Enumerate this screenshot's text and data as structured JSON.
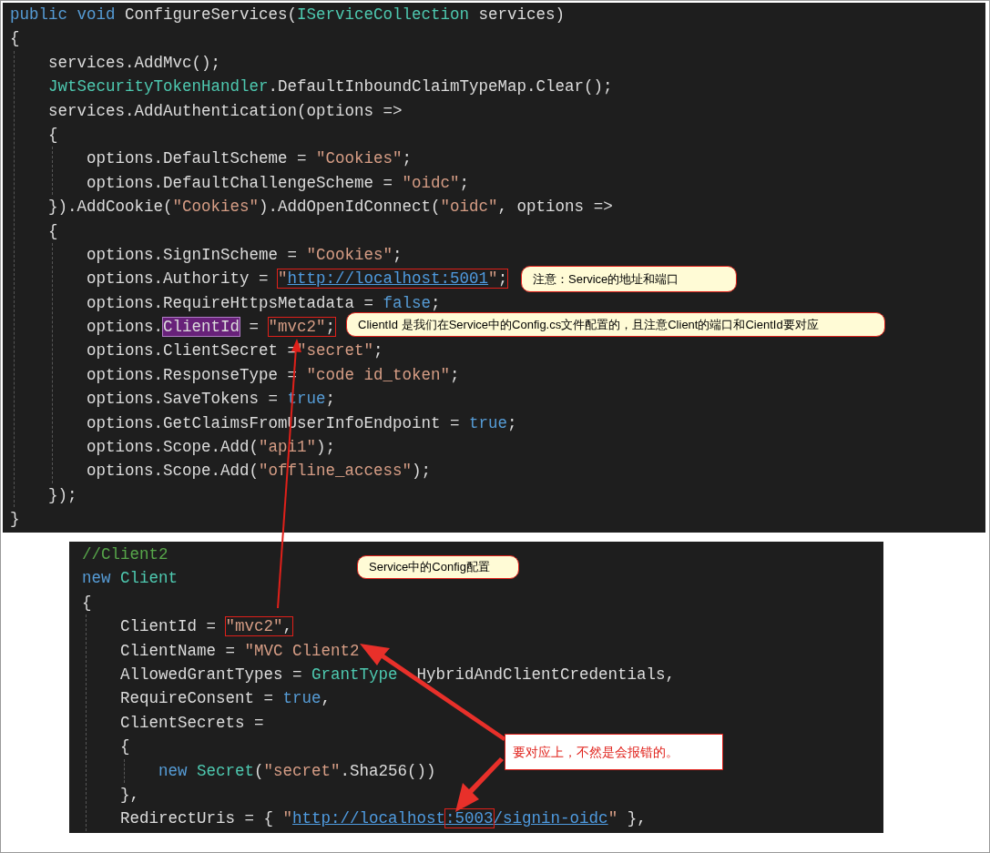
{
  "main_code": {
    "lines": [
      [
        {
          "kind": "keyword",
          "text": "public void"
        },
        {
          "kind": "plain",
          "text": " ConfigureServices("
        },
        {
          "kind": "type",
          "text": "IServiceCollection"
        },
        {
          "kind": "plain",
          "text": " services)"
        }
      ],
      [
        {
          "kind": "plain",
          "text": "{"
        }
      ],
      {
        "children": [
          [
            {
              "kind": "plain",
              "text": "services.AddMvc();"
            }
          ],
          [
            {
              "kind": "type",
              "text": "JwtSecurityTokenHandler"
            },
            {
              "kind": "plain",
              "text": ".DefaultInboundClaimTypeMap.Clear();"
            }
          ],
          [
            {
              "kind": "plain",
              "text": "services.AddAuthentication(options =>"
            }
          ],
          [
            {
              "kind": "plain",
              "text": "{"
            }
          ],
          {
            "children": [
              [
                {
                  "kind": "plain",
                  "text": "options.DefaultScheme = "
                },
                {
                  "kind": "string",
                  "text": "\"Cookies\""
                },
                {
                  "kind": "plain",
                  "text": ";"
                }
              ],
              [
                {
                  "kind": "plain",
                  "text": "options.DefaultChallengeScheme = "
                },
                {
                  "kind": "string",
                  "text": "\"oidc\""
                },
                {
                  "kind": "plain",
                  "text": ";"
                }
              ]
            ]
          },
          [
            {
              "kind": "plain",
              "text": "}).AddCookie("
            },
            {
              "kind": "string",
              "text": "\"Cookies\""
            },
            {
              "kind": "plain",
              "text": ").AddOpenIdConnect("
            },
            {
              "kind": "string",
              "text": "\"oidc\""
            },
            {
              "kind": "plain",
              "text": ", options =>"
            }
          ],
          [
            {
              "kind": "plain",
              "text": "{"
            }
          ],
          {
            "children": [
              [
                {
                  "kind": "plain",
                  "text": "options.SignInScheme = "
                },
                {
                  "kind": "string",
                  "text": "\"Cookies\""
                },
                {
                  "kind": "plain",
                  "text": ";"
                }
              ],
              [
                {
                  "kind": "plain",
                  "text": "options.Authority = "
                },
                {
                  "kind": "boxed",
                  "parts": [
                    {
                      "kind": "string",
                      "text": "\""
                    },
                    {
                      "kind": "link",
                      "text": "http://localhost:5001"
                    },
                    {
                      "kind": "string",
                      "text": "\""
                    },
                    {
                      "kind": "plain",
                      "text": ";"
                    }
                  ]
                }
              ],
              [
                {
                  "kind": "plain",
                  "text": "options.RequireHttpsMetadata = "
                },
                {
                  "kind": "keyword",
                  "text": "false"
                },
                {
                  "kind": "plain",
                  "text": ";"
                }
              ],
              [
                {
                  "kind": "plain",
                  "text": "options."
                },
                {
                  "kind": "highlight",
                  "text": "ClientId"
                },
                {
                  "kind": "plain",
                  "text": " = "
                },
                {
                  "kind": "boxed",
                  "parts": [
                    {
                      "kind": "string",
                      "text": "\"mvc2\""
                    },
                    {
                      "kind": "plain",
                      "text": ";"
                    }
                  ]
                }
              ],
              [
                {
                  "kind": "plain",
                  "text": "options.ClientSecret ="
                },
                {
                  "kind": "string",
                  "text": "\"secret\""
                },
                {
                  "kind": "plain",
                  "text": ";"
                }
              ],
              [
                {
                  "kind": "plain",
                  "text": "options.ResponseType = "
                },
                {
                  "kind": "string",
                  "text": "\"code id_token\""
                },
                {
                  "kind": "plain",
                  "text": ";"
                }
              ],
              [
                {
                  "kind": "plain",
                  "text": "options.SaveTokens = "
                },
                {
                  "kind": "keyword",
                  "text": "true"
                },
                {
                  "kind": "plain",
                  "text": ";"
                }
              ],
              [
                {
                  "kind": "plain",
                  "text": "options.GetClaimsFromUserInfoEndpoint = "
                },
                {
                  "kind": "keyword",
                  "text": "true"
                },
                {
                  "kind": "plain",
                  "text": ";"
                }
              ],
              [
                {
                  "kind": "plain",
                  "text": "options.Scope.Add("
                },
                {
                  "kind": "string",
                  "text": "\"api1\""
                },
                {
                  "kind": "plain",
                  "text": ");"
                }
              ],
              [
                {
                  "kind": "plain",
                  "text": "options.Scope.Add("
                },
                {
                  "kind": "string",
                  "text": "\"offline_access\""
                },
                {
                  "kind": "plain",
                  "text": ");"
                }
              ]
            ]
          },
          [
            {
              "kind": "plain",
              "text": "});"
            }
          ]
        ]
      },
      [
        {
          "kind": "plain",
          "text": "}"
        }
      ]
    ]
  },
  "config_code": {
    "lines": [
      [
        {
          "kind": "comment",
          "text": "//Client2"
        }
      ],
      [
        {
          "kind": "keyword",
          "text": "new "
        },
        {
          "kind": "type",
          "text": "Client"
        }
      ],
      [
        {
          "kind": "plain",
          "text": "{"
        }
      ],
      {
        "children": [
          [
            {
              "kind": "plain",
              "text": "ClientId = "
            },
            {
              "kind": "boxed",
              "parts": [
                {
                  "kind": "string",
                  "text": "\"mvc2\""
                },
                {
                  "kind": "plain",
                  "text": ","
                }
              ]
            }
          ],
          [
            {
              "kind": "plain",
              "text": "ClientName = "
            },
            {
              "kind": "string",
              "text": "\"MVC Client2"
            }
          ],
          [
            {
              "kind": "plain",
              "text": "AllowedGrantTypes = "
            },
            {
              "kind": "type",
              "text": "GrantType"
            },
            {
              "kind": "gap"
            },
            {
              "kind": "plain",
              "text": "HybridAndClientCredentials,"
            }
          ],
          [
            {
              "kind": "plain",
              "text": "RequireConsent = "
            },
            {
              "kind": "keyword",
              "text": "true"
            },
            {
              "kind": "plain",
              "text": ","
            }
          ],
          [
            {
              "kind": "plain",
              "text": "ClientSecrets ="
            }
          ],
          [
            {
              "kind": "plain",
              "text": "{"
            }
          ],
          {
            "children": [
              [
                {
                  "kind": "keyword",
                  "text": "new "
                },
                {
                  "kind": "type",
                  "text": "Secret"
                },
                {
                  "kind": "plain",
                  "text": "("
                },
                {
                  "kind": "string",
                  "text": "\"secret\""
                },
                {
                  "kind": "plain",
                  "text": ".Sha256())"
                }
              ]
            ]
          },
          [
            {
              "kind": "plain",
              "text": "},"
            }
          ],
          [
            {
              "kind": "plain",
              "text": "RedirectUris = { "
            },
            {
              "kind": "string",
              "text": "\""
            },
            {
              "kind": "link",
              "text": "http://localhost"
            },
            {
              "kind": "boxed",
              "parts": [
                {
                  "kind": "link",
                  "text": ":5003"
                }
              ]
            },
            {
              "kind": "link",
              "text": "/signin-oidc"
            },
            {
              "kind": "string",
              "text": "\""
            },
            {
              "kind": "plain",
              "text": " },"
            }
          ]
        ]
      }
    ]
  },
  "callouts": [
    {
      "kind": "bubble",
      "text": "注意：Service的地址和端口"
    },
    {
      "kind": "bubble",
      "text": "ClientId 是我们在Service中的Config.cs文件配置的，且注意Client的端口和CientId要对应"
    },
    {
      "kind": "bubble",
      "text": "Service中的Config配置"
    },
    {
      "kind": "note",
      "text": "要对应上，不然是会报错的。"
    }
  ]
}
